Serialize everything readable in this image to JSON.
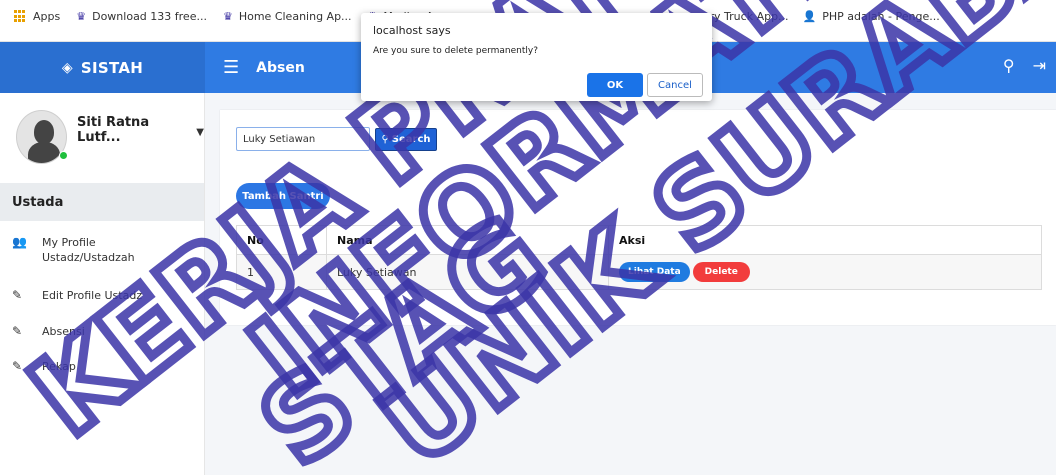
{
  "bookmarks": [
    {
      "label": "Apps",
      "icon": "apps-grid-icon"
    },
    {
      "label": "Download 133 free...",
      "icon": "crown-icon"
    },
    {
      "label": "Home Cleaning Ap...",
      "icon": "crown-icon"
    },
    {
      "label": "Medica A",
      "icon": "crown-icon"
    },
    {
      "label": "ry Truck App...",
      "icon": "crown-icon"
    },
    {
      "label": "PHP adalah - Penge...",
      "icon": "person-icon"
    }
  ],
  "navbar": {
    "brand": "SISTAH",
    "title": "Absen"
  },
  "sidebar": {
    "user_name": "Siti Ratna Lutf...",
    "role": "Ustada",
    "menu": [
      {
        "label": "My Profile Ustadz/Ustadzah",
        "icon": "users-icon"
      },
      {
        "label": "Edit Profile Ustadz",
        "icon": "edit-icon"
      },
      {
        "label": "Absensi",
        "icon": "edit-icon"
      },
      {
        "label": "Rekap",
        "icon": "edit-icon"
      }
    ]
  },
  "main": {
    "search_value": "Luky Setiawan",
    "search_button": "Search",
    "add_button": "Tambah Santri",
    "table": {
      "headers": [
        "No",
        "Nama",
        "Aksi"
      ],
      "rows": [
        {
          "no": "1",
          "nama": "Luky Setiawan",
          "lihat": "Lihat Data",
          "delete": "Delete"
        }
      ]
    }
  },
  "dialog": {
    "title": "localhost says",
    "message": "Are you sure to delete permanently?",
    "ok": "OK",
    "cancel": "Cancel"
  },
  "watermark": [
    "KERJA PRAKTIK",
    "INFORMATIKA",
    "UNIK SURABAYA",
    "STAG"
  ]
}
